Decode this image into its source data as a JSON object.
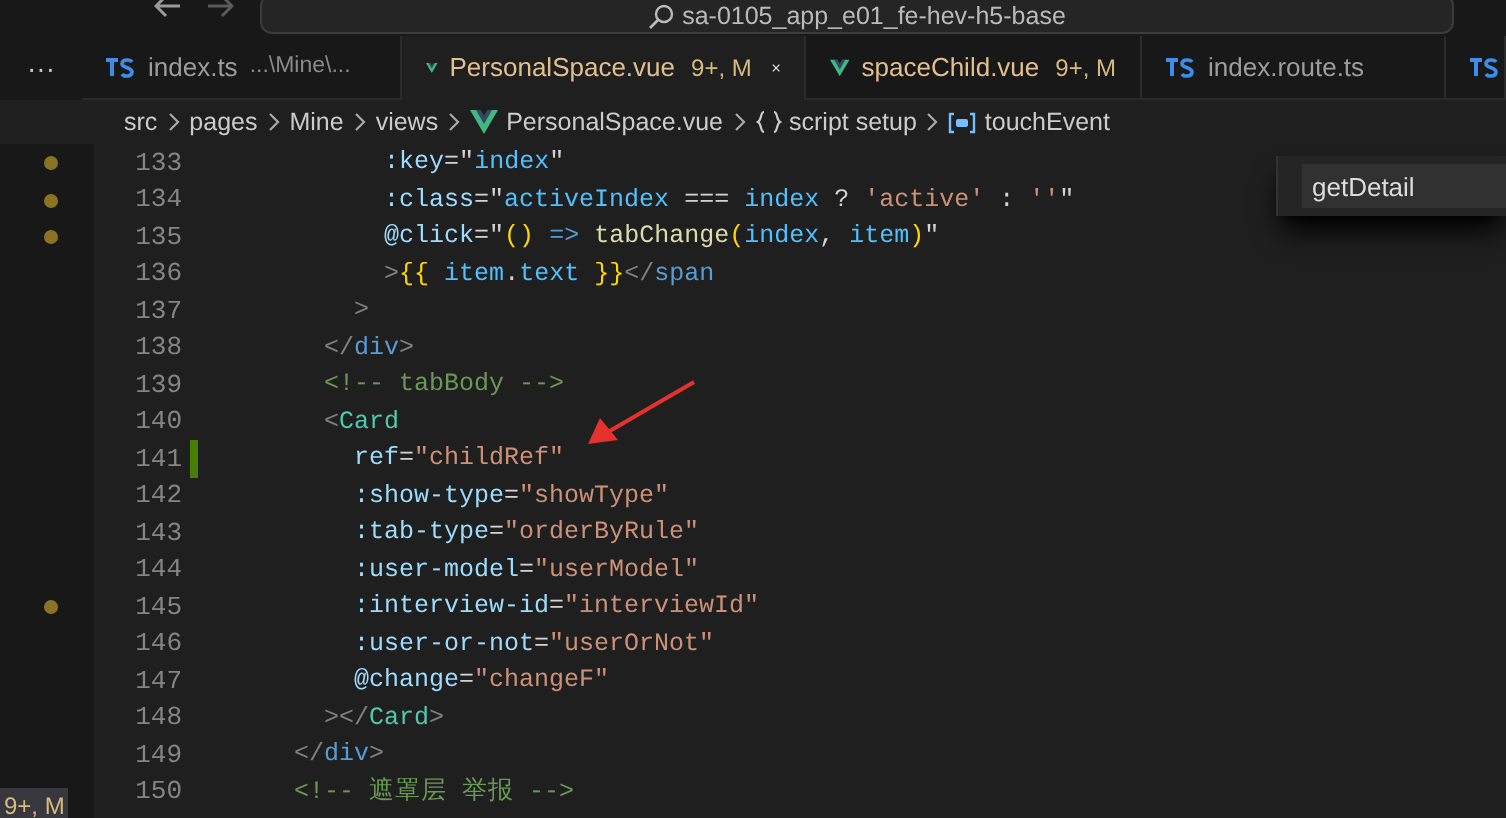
{
  "title_bar": {
    "search_text": "sa-0105_app_e01_fe-hev-h5-base"
  },
  "tab_bar": {
    "more": "···"
  },
  "tabs": [
    {
      "label": "index.ts",
      "kind": "ts",
      "detail": "...\\Mine\\...",
      "selected": false,
      "problem": false
    },
    {
      "label": "PersonalSpace.vue",
      "kind": "vue",
      "status": "9+, M",
      "selected": true,
      "problem": true
    },
    {
      "label": "spaceChild.vue",
      "kind": "vue",
      "status": "9+, M",
      "selected": false,
      "problem": true
    },
    {
      "label": "index.route.ts",
      "kind": "ts",
      "selected": false,
      "problem": false
    },
    {
      "kind": "ts",
      "selected": false
    }
  ],
  "breadcrumb": [
    {
      "label": "src",
      "kind": "folder"
    },
    {
      "label": "pages",
      "kind": "folder"
    },
    {
      "label": "Mine",
      "kind": "folder"
    },
    {
      "label": "views",
      "kind": "folder"
    },
    {
      "label": "PersonalSpace.vue",
      "kind": "vue"
    },
    {
      "label": "script setup",
      "kind": "braces"
    },
    {
      "label": "touchEvent",
      "kind": "symbol"
    }
  ],
  "find_widget": {
    "value": "getDetail"
  },
  "side_panel": {
    "badge": "9+, M"
  },
  "lines": [
    {
      "number": "133",
      "dot": true,
      "modified": false,
      "tokens": [
        {
          "text": "            :key",
          "kind": "attr"
        },
        {
          "text": "=",
          "kind": "punct"
        },
        {
          "text": "\"",
          "kind": "punct"
        },
        {
          "text": "index",
          "kind": "var"
        },
        {
          "text": "\"",
          "kind": "punct"
        }
      ]
    },
    {
      "number": "134",
      "dot": true,
      "modified": false,
      "tokens": [
        {
          "text": "            :class",
          "kind": "attr"
        },
        {
          "text": "=\"",
          "kind": "punct"
        },
        {
          "text": "activeIndex",
          "kind": "var"
        },
        {
          "text": " === ",
          "kind": "punct"
        },
        {
          "text": "index",
          "kind": "var"
        },
        {
          "text": " ? ",
          "kind": "punct"
        },
        {
          "text": "'active'",
          "kind": "str"
        },
        {
          "text": " : ",
          "kind": "punct"
        },
        {
          "text": "''",
          "kind": "str"
        },
        {
          "text": "\"",
          "kind": "punct"
        }
      ]
    },
    {
      "number": "135",
      "dot": true,
      "modified": false,
      "tokens": [
        {
          "text": "            @click",
          "kind": "attr"
        },
        {
          "text": "=\"",
          "kind": "punct"
        },
        {
          "text": "()",
          "kind": "brace"
        },
        {
          "text": " => ",
          "kind": "keyword"
        },
        {
          "text": "tabChange",
          "kind": "func"
        },
        {
          "text": "(",
          "kind": "brace"
        },
        {
          "text": "index",
          "kind": "var"
        },
        {
          "text": ", ",
          "kind": "punct"
        },
        {
          "text": "item",
          "kind": "var"
        },
        {
          "text": ")",
          "kind": "brace"
        },
        {
          "text": "\"",
          "kind": "punct"
        }
      ]
    },
    {
      "number": "136",
      "dot": false,
      "modified": false,
      "tokens": [
        {
          "text": "            >",
          "kind": "bracket"
        },
        {
          "text": "{{",
          "kind": "brace"
        },
        {
          "text": " item",
          "kind": "var"
        },
        {
          "text": ".",
          "kind": "punct"
        },
        {
          "text": "text",
          "kind": "var"
        },
        {
          "text": " }}",
          "kind": "brace"
        },
        {
          "text": "</",
          "kind": "bracket"
        },
        {
          "text": "span",
          "kind": "tag"
        }
      ]
    },
    {
      "number": "137",
      "dot": false,
      "modified": false,
      "tokens": [
        {
          "text": "          >",
          "kind": "bracket"
        }
      ]
    },
    {
      "number": "138",
      "dot": false,
      "modified": false,
      "tokens": [
        {
          "text": "        </",
          "kind": "bracket"
        },
        {
          "text": "div",
          "kind": "tag"
        },
        {
          "text": ">",
          "kind": "bracket"
        }
      ]
    },
    {
      "number": "139",
      "dot": false,
      "modified": false,
      "tokens": [
        {
          "text": "        <!-- tabBody -->",
          "kind": "comment"
        }
      ]
    },
    {
      "number": "140",
      "dot": false,
      "modified": false,
      "tokens": [
        {
          "text": "        <",
          "kind": "bracket"
        },
        {
          "text": "Card",
          "kind": "comp"
        }
      ]
    },
    {
      "number": "141",
      "dot": false,
      "modified": true,
      "tokens": [
        {
          "text": "          ref",
          "kind": "attr"
        },
        {
          "text": "=",
          "kind": "punct"
        },
        {
          "text": "\"childRef\"",
          "kind": "str"
        }
      ]
    },
    {
      "number": "142",
      "dot": false,
      "modified": false,
      "tokens": [
        {
          "text": "          :show-type",
          "kind": "attr"
        },
        {
          "text": "=",
          "kind": "punct"
        },
        {
          "text": "\"showType\"",
          "kind": "str"
        }
      ]
    },
    {
      "number": "143",
      "dot": false,
      "modified": false,
      "tokens": [
        {
          "text": "          :tab-type",
          "kind": "attr"
        },
        {
          "text": "=",
          "kind": "punct"
        },
        {
          "text": "\"orderByRule\"",
          "kind": "str"
        }
      ]
    },
    {
      "number": "144",
      "dot": false,
      "modified": false,
      "tokens": [
        {
          "text": "          :user-model",
          "kind": "attr"
        },
        {
          "text": "=",
          "kind": "punct"
        },
        {
          "text": "\"userModel\"",
          "kind": "str"
        }
      ]
    },
    {
      "number": "145",
      "dot": true,
      "modified": false,
      "tokens": [
        {
          "text": "          :interview-id",
          "kind": "attr"
        },
        {
          "text": "=",
          "kind": "punct"
        },
        {
          "text": "\"interviewId\"",
          "kind": "str"
        }
      ]
    },
    {
      "number": "146",
      "dot": false,
      "modified": false,
      "tokens": [
        {
          "text": "          :user-or-not",
          "kind": "attr"
        },
        {
          "text": "=",
          "kind": "punct"
        },
        {
          "text": "\"userOrNot\"",
          "kind": "str"
        }
      ]
    },
    {
      "number": "147",
      "dot": false,
      "modified": false,
      "tokens": [
        {
          "text": "          @change",
          "kind": "attr"
        },
        {
          "text": "=",
          "kind": "punct"
        },
        {
          "text": "\"changeF\"",
          "kind": "str"
        }
      ]
    },
    {
      "number": "148",
      "dot": false,
      "modified": false,
      "tokens": [
        {
          "text": "        ></",
          "kind": "bracket"
        },
        {
          "text": "Card",
          "kind": "comp"
        },
        {
          "text": ">",
          "kind": "bracket"
        }
      ]
    },
    {
      "number": "149",
      "dot": false,
      "modified": false,
      "tokens": [
        {
          "text": "      </",
          "kind": "bracket"
        },
        {
          "text": "div",
          "kind": "tag"
        },
        {
          "text": ">",
          "kind": "bracket"
        }
      ]
    },
    {
      "number": "150",
      "dot": false,
      "modified": false,
      "tokens": [
        {
          "text": "      <!-- 遮罩层 举报 -->",
          "kind": "comment"
        }
      ]
    }
  ],
  "annotation": {
    "kind": "arrow"
  }
}
